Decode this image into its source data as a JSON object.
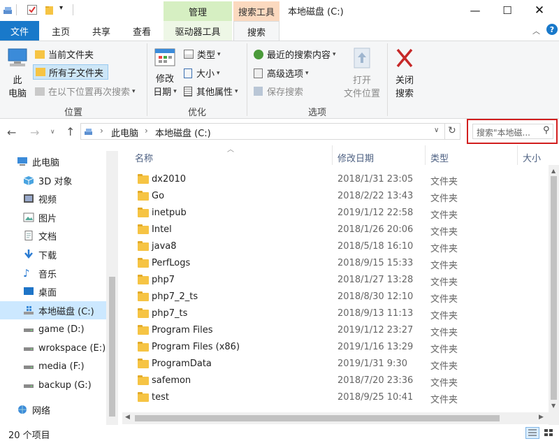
{
  "titlebar": {
    "title": "本地磁盘 (C:)",
    "context_manage": "管理",
    "context_search_tools": "搜索工具",
    "min_icon": "minimize-icon",
    "max_icon": "maximize-icon",
    "close_icon": "close-icon"
  },
  "tabs": {
    "file": "文件",
    "home": "主页",
    "share": "共享",
    "view": "查看",
    "drive_tools": "驱动器工具",
    "search": "搜索"
  },
  "ribbon": {
    "location": {
      "this_pc_line1": "此",
      "this_pc_line2": "电脑",
      "current_folder": "当前文件夹",
      "all_subfolders": "所有子文件夹",
      "search_again": "在以下位置再次搜索",
      "group": "位置"
    },
    "refine": {
      "date_line1": "修改",
      "date_line2": "日期",
      "type": "类型",
      "size": "大小",
      "other": "其他属性",
      "group": "优化"
    },
    "options": {
      "recent": "最近的搜索内容",
      "advanced": "高级选项",
      "save": "保存搜索",
      "open_line1": "打开",
      "open_line2": "文件位置",
      "group": "选项"
    },
    "close": {
      "line1": "关闭",
      "line2": "搜索"
    }
  },
  "nav": {
    "crumb1": "此电脑",
    "crumb2": "本地磁盘 (C:)",
    "search_placeholder": "搜索\"本地磁..."
  },
  "sidebar": {
    "items": [
      {
        "label": "此电脑",
        "icon": "computer-icon"
      },
      {
        "label": "3D 对象",
        "icon": "cube-icon"
      },
      {
        "label": "视频",
        "icon": "video-icon"
      },
      {
        "label": "图片",
        "icon": "picture-icon"
      },
      {
        "label": "文档",
        "icon": "document-icon"
      },
      {
        "label": "下载",
        "icon": "download-icon"
      },
      {
        "label": "音乐",
        "icon": "music-icon"
      },
      {
        "label": "桌面",
        "icon": "desktop-icon"
      },
      {
        "label": "本地磁盘 (C:)",
        "icon": "drive-icon"
      },
      {
        "label": "game (D:)",
        "icon": "drive-icon"
      },
      {
        "label": "wrokspace (E:)",
        "icon": "drive-icon"
      },
      {
        "label": "media (F:)",
        "icon": "drive-icon"
      },
      {
        "label": "backup (G:)",
        "icon": "drive-icon"
      },
      {
        "label": "网络",
        "icon": "network-icon"
      }
    ]
  },
  "columns": {
    "name": "名称",
    "date": "修改日期",
    "type": "类型",
    "size": "大小"
  },
  "files": [
    {
      "name": "dx2010",
      "date": "2018/1/31 23:05",
      "type": "文件夹"
    },
    {
      "name": "Go",
      "date": "2018/2/22 13:43",
      "type": "文件夹"
    },
    {
      "name": "inetpub",
      "date": "2019/1/12 22:58",
      "type": "文件夹"
    },
    {
      "name": "Intel",
      "date": "2018/1/26 20:06",
      "type": "文件夹"
    },
    {
      "name": "java8",
      "date": "2018/5/18 16:10",
      "type": "文件夹"
    },
    {
      "name": "PerfLogs",
      "date": "2018/9/15 15:33",
      "type": "文件夹"
    },
    {
      "name": "php7",
      "date": "2018/1/27 13:28",
      "type": "文件夹"
    },
    {
      "name": "php7_2_ts",
      "date": "2018/8/30 12:10",
      "type": "文件夹"
    },
    {
      "name": "php7_ts",
      "date": "2018/9/13 11:13",
      "type": "文件夹"
    },
    {
      "name": "Program Files",
      "date": "2019/1/12 23:27",
      "type": "文件夹"
    },
    {
      "name": "Program Files (x86)",
      "date": "2019/1/16 13:29",
      "type": "文件夹"
    },
    {
      "name": "ProgramData",
      "date": "2019/1/31 9:30",
      "type": "文件夹"
    },
    {
      "name": "safemon",
      "date": "2018/7/20 23:36",
      "type": "文件夹"
    },
    {
      "name": "test",
      "date": "2018/9/25 10:41",
      "type": "文件夹"
    }
  ],
  "status": {
    "count": "20 个项目"
  }
}
